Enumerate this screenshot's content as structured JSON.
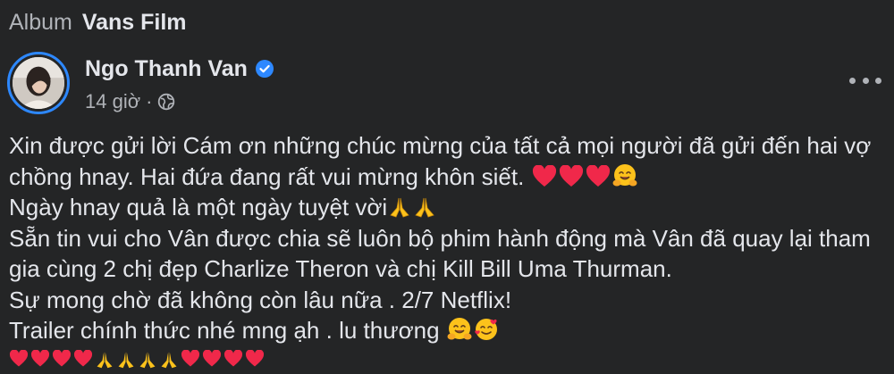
{
  "album": {
    "prefix": "Album",
    "name": "Vans Film"
  },
  "author": {
    "name": "Ngo Thanh Van",
    "verified_icon": "verified-badge-icon"
  },
  "meta": {
    "time": "14 giờ",
    "separator": "·",
    "audience_icon": "globe-icon"
  },
  "post": {
    "line1": "Xin được gửi lời Cám ơn những chúc mừng của tất cả mọi người đã gửi đến hai vợ",
    "line2": "chồng hnay. Hai đứa đang rất vui mừng khôn siết. ",
    "line3": "Ngày hnay quả là một ngày tuyệt vời",
    "line4": "Sẵn tin vui cho Vân được chia sẽ luôn bộ phim hành động mà Vân đã quay lại tham",
    "line5": "gia cùng 2 chị đẹp Charlize Theron và chị Kill Bill Uma Thurman.",
    "line6": "Sự mong chờ đã không còn lâu nữa . 2/7 Netflix!",
    "line7": "Trailer chính thức nhé mng ạh . lu thương "
  },
  "colors": {
    "background": "#242526",
    "text_primary": "#e4e6eb",
    "text_secondary": "#b0b3b8",
    "accent": "#2d88ff",
    "heart": "#f0284a",
    "emoji_yellow": "#fcc21b"
  }
}
